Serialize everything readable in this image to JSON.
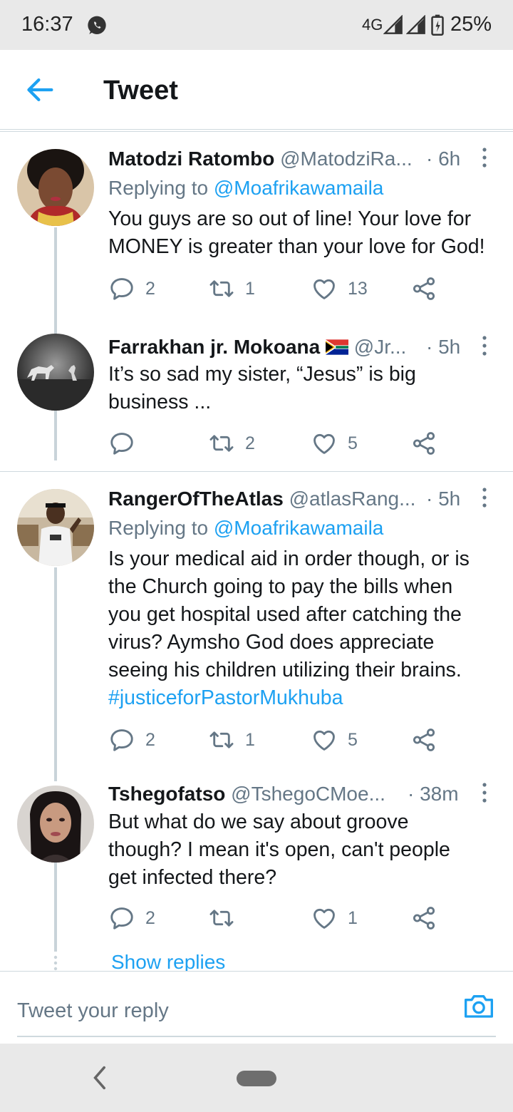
{
  "status_bar": {
    "time": "16:37",
    "network": "4G",
    "battery": "25%"
  },
  "header": {
    "title": "Tweet"
  },
  "tweets": [
    {
      "name": "Matodzi Ratombo",
      "handle": "@MatodziRa...",
      "time": "· 6h",
      "replying_prefix": "Replying to ",
      "replying_to": "@Moafrikawamaila",
      "lines": [
        "You guys are so out of line! Your love for",
        "MONEY is greater than your love for God!"
      ],
      "replies": "2",
      "retweets": "1",
      "likes": "13"
    },
    {
      "name": "Farrakhan jr. Mokoana",
      "handle": "@Jr...",
      "time": "· 5h",
      "lines": [
        "It’s so sad my sister, “Jesus” is big",
        "business ..."
      ],
      "replies": "",
      "retweets": "2",
      "likes": "5"
    },
    {
      "name": "RangerOfTheAtlas",
      "handle": "@atlasRang...",
      "time": "· 5h",
      "replying_prefix": "Replying to ",
      "replying_to": "@Moafrikawamaila",
      "lines": [
        "Is your medical aid in order though, or is",
        "the Church going to pay the bills when",
        "you get hospital used after catching the",
        "virus? Aymsho God does appreciate",
        "seeing his children utilizing their brains."
      ],
      "hashtag": "#justiceforPastorMukhuba",
      "replies": "2",
      "retweets": "1",
      "likes": "5"
    },
    {
      "name": "Tshegofatso",
      "handle": "@TshegoCMoe...",
      "time": "· 38m",
      "lines": [
        "But what do we say about groove",
        "though? I mean it's open, can't people",
        "get infected there?"
      ],
      "replies": "2",
      "retweets": "",
      "likes": "1"
    }
  ],
  "show_replies": "Show replies",
  "reply_bar": {
    "placeholder": "Tweet your reply"
  },
  "icons": [
    "whatsapp-icon",
    "signal-icon",
    "battery-icon",
    "back-arrow-icon",
    "more-vertical-icon",
    "reply-icon",
    "retweet-icon",
    "like-icon",
    "share-icon",
    "camera-icon",
    "flag-south-africa-icon",
    "nav-back-icon",
    "nav-home-pill"
  ],
  "colors": {
    "accent": "#1da1f2",
    "secondary_text": "#657786",
    "divider": "#cfd9de",
    "system_bar": "#e9e9e9"
  }
}
